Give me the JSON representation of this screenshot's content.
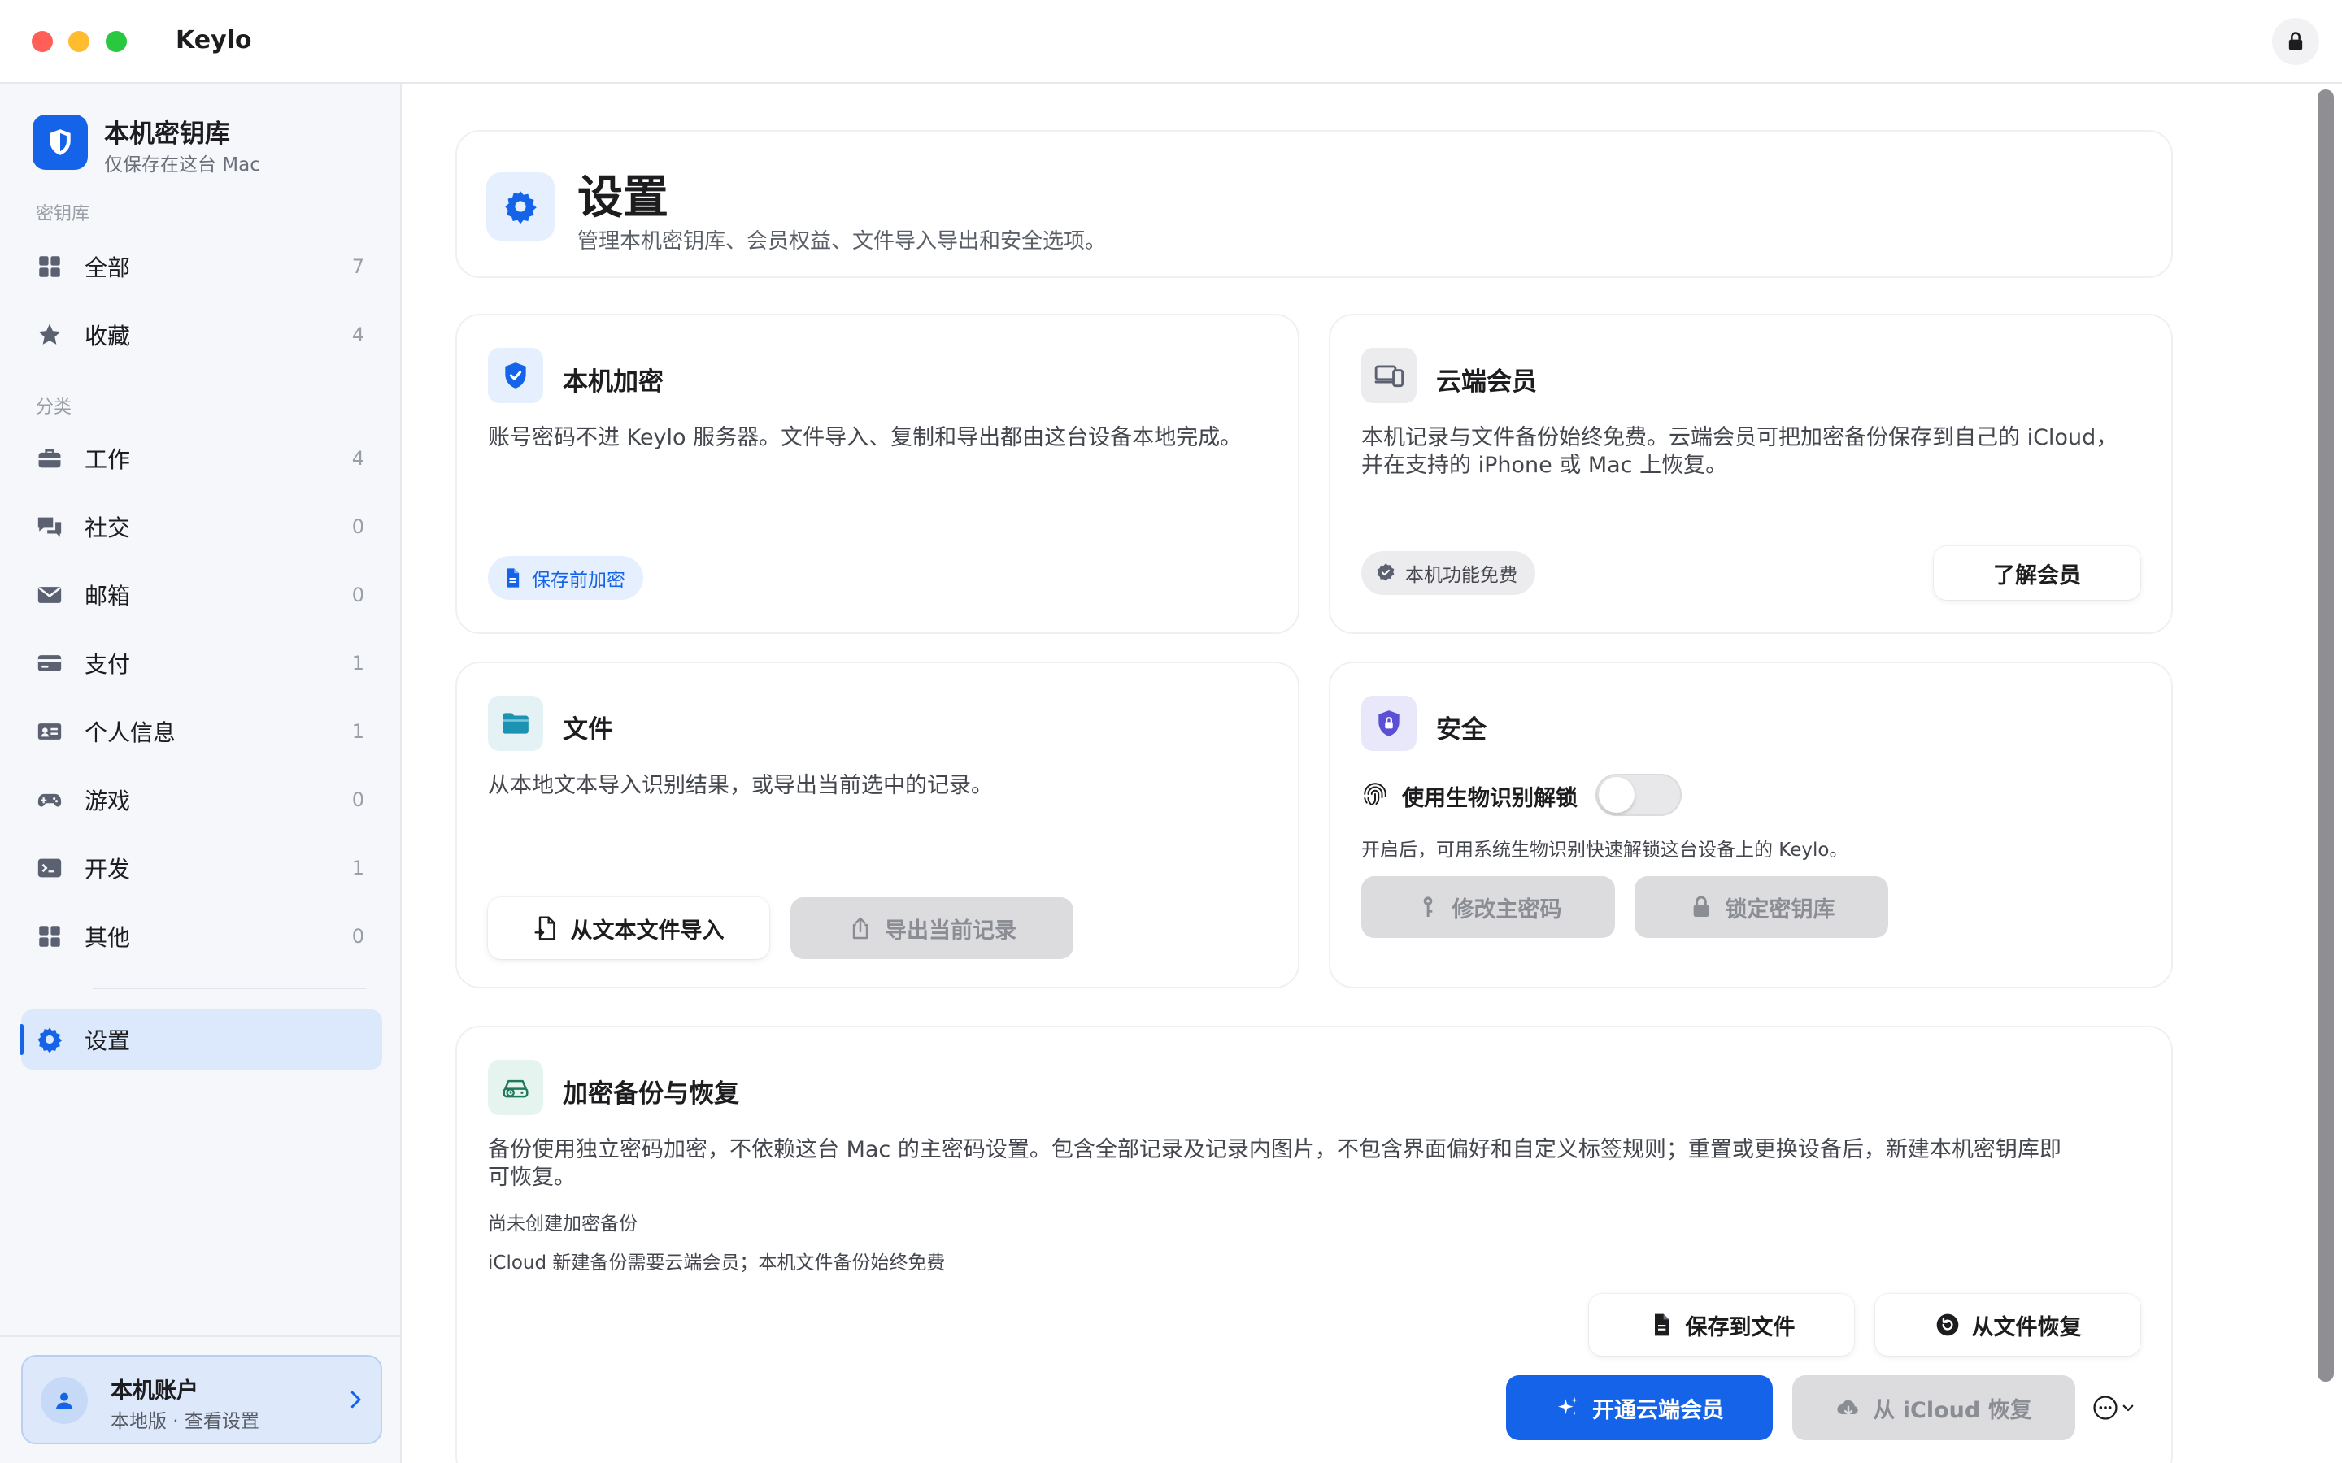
{
  "app": {
    "title": "Keylo"
  },
  "colors": {
    "accent": "#1463e8",
    "sidebar_bg": "#f5f7fb",
    "active_bg": "#dce8fb"
  },
  "sidebar": {
    "brand_title": "本机密钥库",
    "brand_subtitle": "仅保存在这台 Mac",
    "vault_section": "密钥库",
    "category_section": "分类",
    "vault_items": [
      {
        "label": "全部",
        "count": "7",
        "icon": "grid-icon"
      },
      {
        "label": "收藏",
        "count": "4",
        "icon": "star-icon"
      }
    ],
    "category_items": [
      {
        "label": "工作",
        "count": "4",
        "icon": "briefcase-icon"
      },
      {
        "label": "社交",
        "count": "0",
        "icon": "chat-bubbles-icon"
      },
      {
        "label": "邮箱",
        "count": "0",
        "icon": "envelope-icon"
      },
      {
        "label": "支付",
        "count": "1",
        "icon": "credit-card-icon"
      },
      {
        "label": "个人信息",
        "count": "1",
        "icon": "id-card-icon"
      },
      {
        "label": "游戏",
        "count": "0",
        "icon": "gamepad-icon"
      },
      {
        "label": "开发",
        "count": "1",
        "icon": "terminal-icon"
      },
      {
        "label": "其他",
        "count": "0",
        "icon": "grid-icon"
      }
    ],
    "settings_label": "设置",
    "account": {
      "name": "本机账户",
      "subtitle": "本地版 · 查看设置"
    }
  },
  "header": {
    "title": "设置",
    "subtitle": "管理本机密钥库、会员权益、文件导入导出和安全选项。"
  },
  "encryption_card": {
    "title": "本机加密",
    "description": "账号密码不进 Keylo 服务器。文件导入、复制和导出都由这台设备本地完成。",
    "pill": "保存前加密"
  },
  "cloud_card": {
    "title": "云端会员",
    "description_line1": "本机记录与文件备份始终免费。云端会员可把加密备份保存到自己的 iCloud，",
    "description_line2": "并在支持的 iPhone 或 Mac 上恢复。",
    "pill": "本机功能免费",
    "button": "了解会员"
  },
  "files_card": {
    "title": "文件",
    "description": "从本地文本导入识别结果，或导出当前选中的记录。",
    "import_button": "从文本文件导入",
    "export_button": "导出当前记录"
  },
  "security_card": {
    "title": "安全",
    "biometric_label": "使用生物识别解锁",
    "biometric_enabled": false,
    "hint": "开启后，可用系统生物识别快速解锁这台设备上的 Keylo。",
    "change_password_button": "修改主密码",
    "lock_vault_button": "锁定密钥库"
  },
  "backup_card": {
    "title": "加密备份与恢复",
    "description_line1": "备份使用独立密码加密，不依赖这台 Mac 的主密码设置。包含全部记录及记录内图片，不包含界面偏好和自定义标签规则；重置或更换设备后，新建本机密钥库即",
    "description_line2": "可恢复。",
    "status": "尚未创建加密备份",
    "note": "iCloud 新建备份需要云端会员；本机文件备份始终免费",
    "save_file_button": "保存到文件",
    "restore_file_button": "从文件恢复",
    "subscribe_button": "开通云端会员",
    "icloud_restore_button": "从 iCloud 恢复"
  }
}
